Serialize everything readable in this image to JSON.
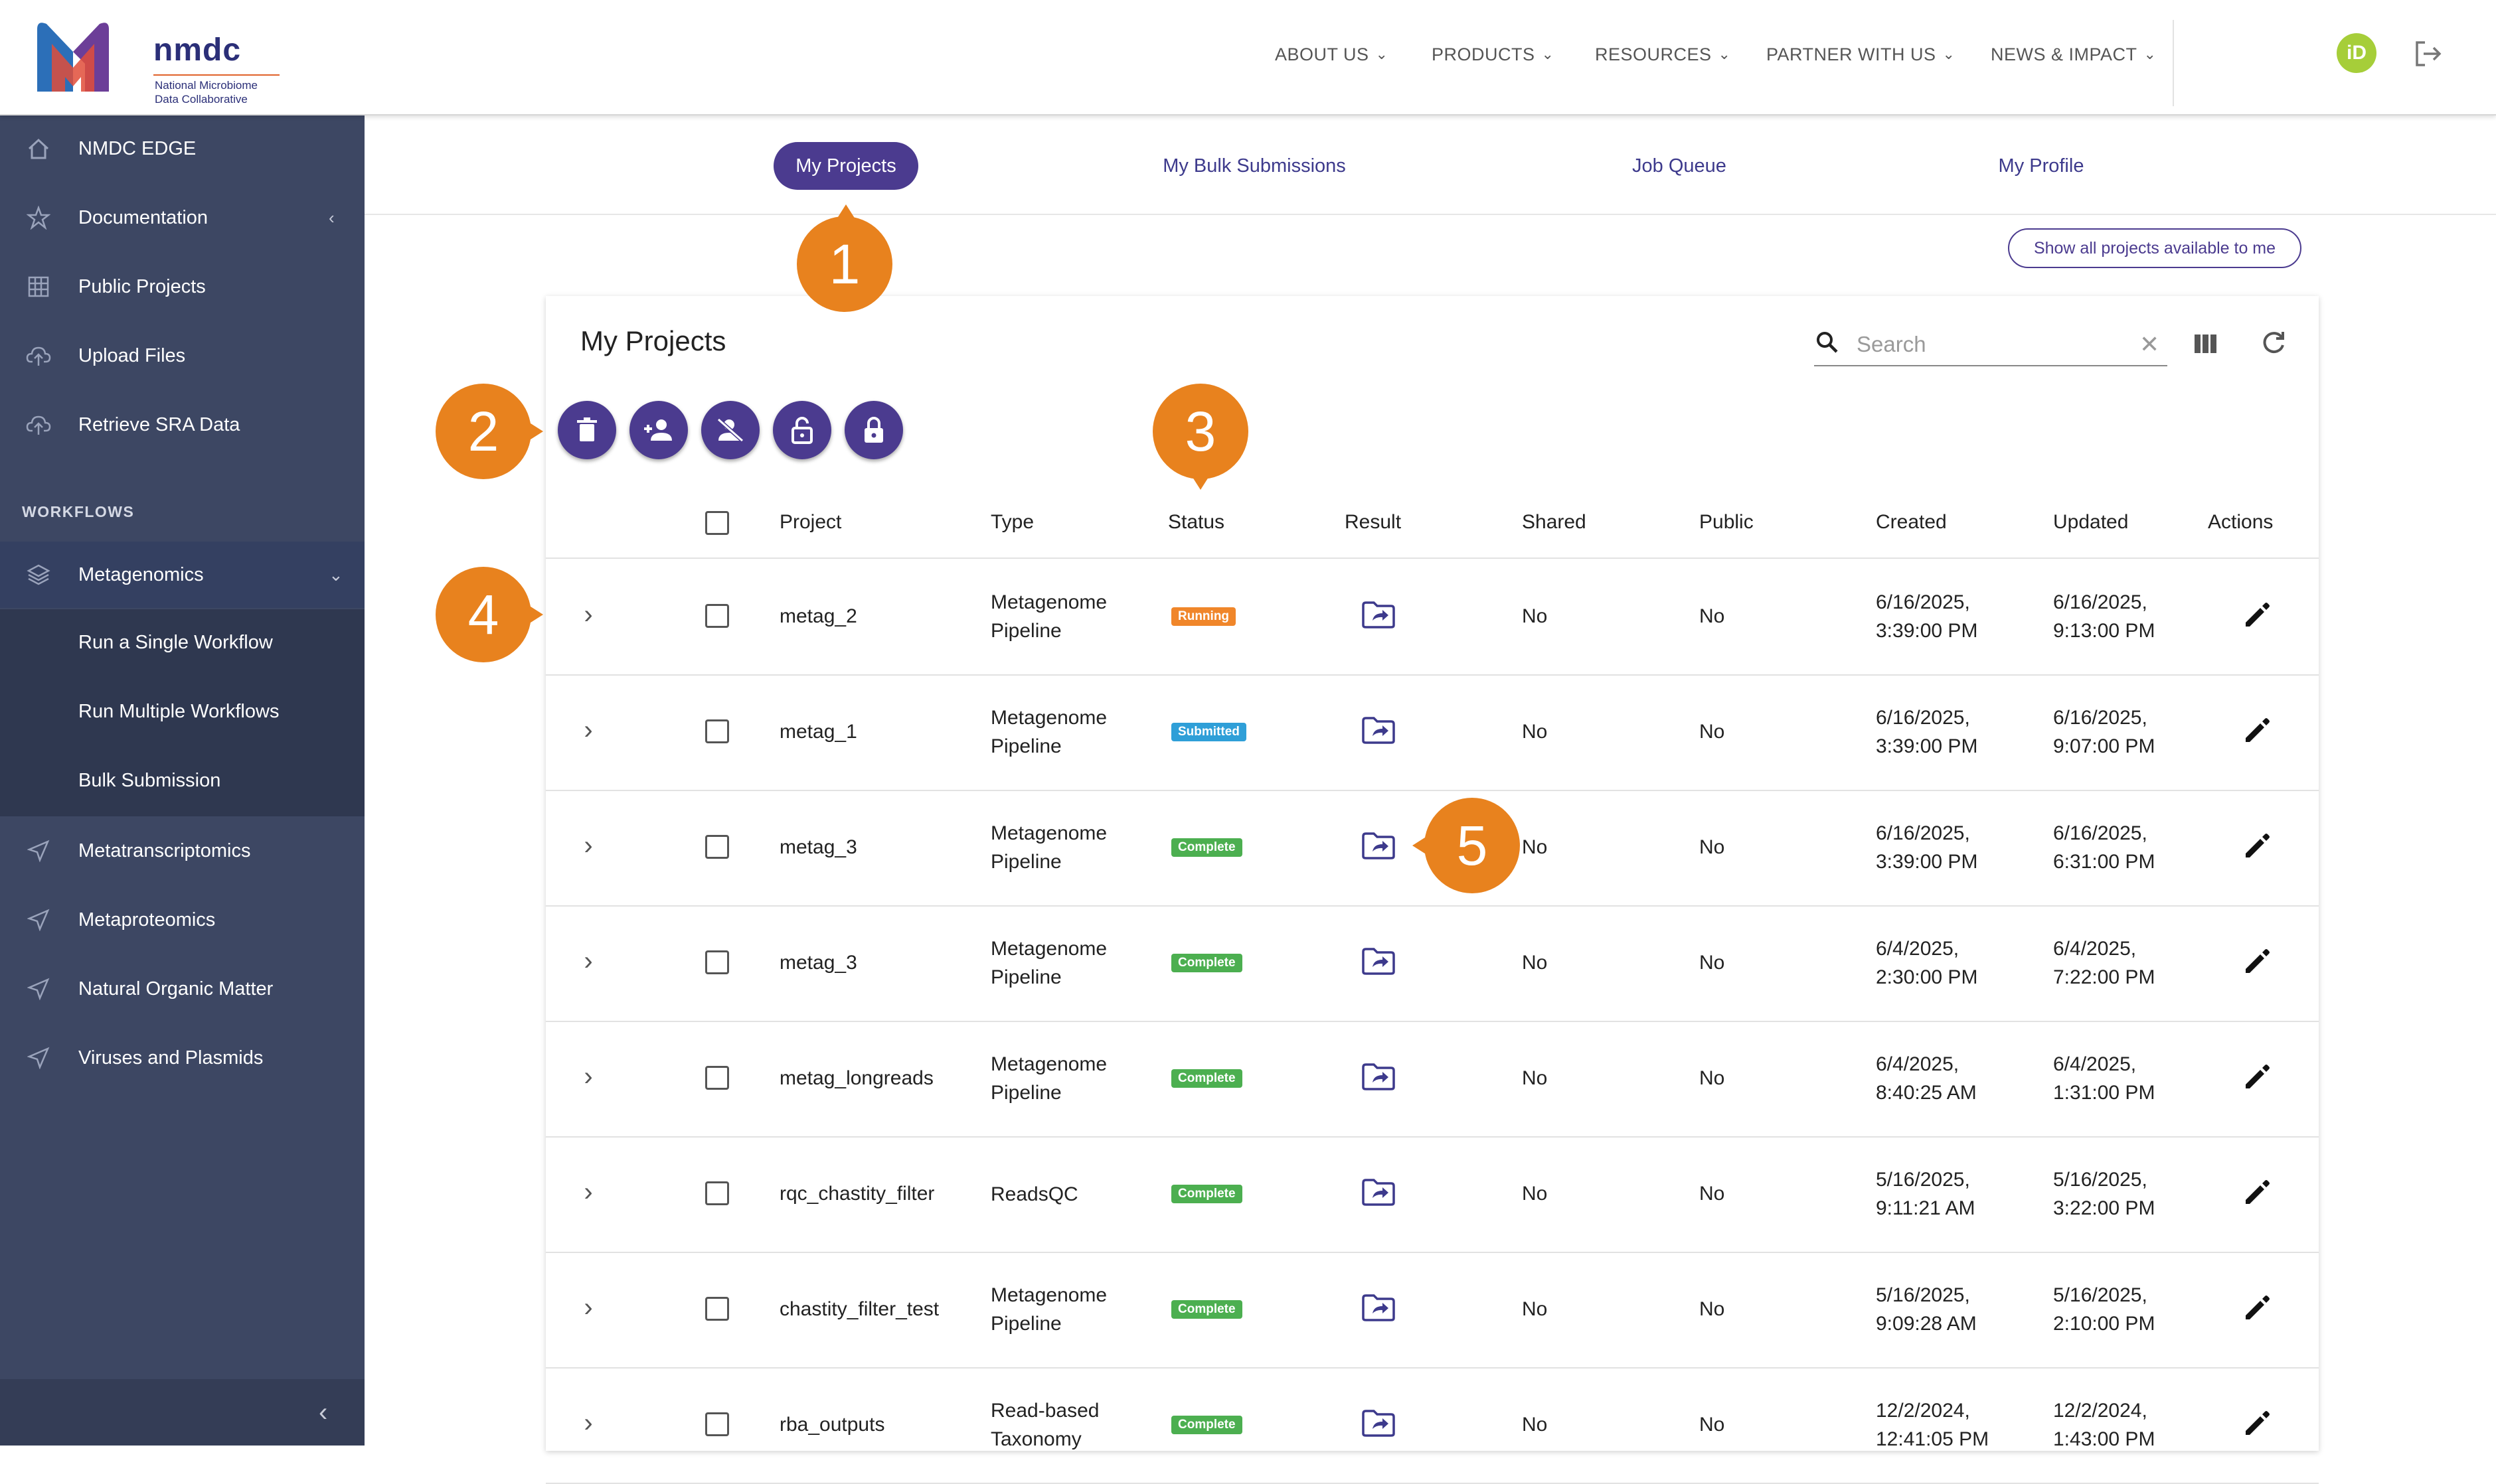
{
  "brand": {
    "name": "nmdc",
    "subtitle": [
      "National Microbiome",
      "Data Collaborative"
    ],
    "colors": {
      "purple": "#4b3b8f",
      "sidebar": "#3d4763",
      "accent": "#e8821e",
      "orcid": "#a6ce39"
    }
  },
  "topnav": [
    {
      "label": "ABOUT US"
    },
    {
      "label": "PRODUCTS"
    },
    {
      "label": "RESOURCES"
    },
    {
      "label": "PARTNER WITH US"
    },
    {
      "label": "NEWS & IMPACT"
    }
  ],
  "header_icons": {
    "orcid": "iD",
    "logout": "logout-icon"
  },
  "sidebar": {
    "items": [
      {
        "label": "NMDC EDGE",
        "icon": "home-icon"
      },
      {
        "label": "Documentation",
        "icon": "star-icon"
      },
      {
        "label": "Public Projects",
        "icon": "grid-icon"
      },
      {
        "label": "Upload Files",
        "icon": "cloud-upload-icon"
      },
      {
        "label": "Retrieve SRA Data",
        "icon": "cloud-download-icon"
      }
    ],
    "section": "WORKFLOWS",
    "workflow_items": [
      {
        "label": "Metagenomics",
        "icon": "layers-icon"
      },
      {
        "label": "Run a Single Workflow"
      },
      {
        "label": "Run Multiple Workflows"
      },
      {
        "label": "Bulk Submission"
      },
      {
        "label": "Metatranscriptomics",
        "icon": "send-icon"
      },
      {
        "label": "Metaproteomics",
        "icon": "send-icon"
      },
      {
        "label": "Natural Organic Matter",
        "icon": "send-icon"
      },
      {
        "label": "Viruses and Plasmids",
        "icon": "send-icon"
      }
    ]
  },
  "tabs": [
    {
      "label": "My Projects",
      "active": true
    },
    {
      "label": "My Bulk Submissions"
    },
    {
      "label": "Job Queue"
    },
    {
      "label": "My Profile"
    }
  ],
  "show_all_label": "Show all projects available to me",
  "table": {
    "title": "My Projects",
    "search_placeholder": "Search",
    "toolbar_icons": [
      "delete-icon",
      "share-user-icon",
      "unshare-user-icon",
      "make-public-icon",
      "make-private-icon"
    ],
    "columns": [
      "Project",
      "Type",
      "Status",
      "Result",
      "Shared",
      "Public",
      "Created",
      "Updated",
      "Actions"
    ],
    "rows": [
      {
        "project": "metag_2",
        "type": [
          "Metagenome",
          "Pipeline"
        ],
        "status": "Running",
        "shared": "No",
        "public": "No",
        "created": [
          "6/16/2025,",
          "3:39:00 PM"
        ],
        "updated": [
          "6/16/2025,",
          "9:13:00 PM"
        ]
      },
      {
        "project": "metag_1",
        "type": [
          "Metagenome",
          "Pipeline"
        ],
        "status": "Submitted",
        "shared": "No",
        "public": "No",
        "created": [
          "6/16/2025,",
          "3:39:00 PM"
        ],
        "updated": [
          "6/16/2025,",
          "9:07:00 PM"
        ]
      },
      {
        "project": "metag_3",
        "type": [
          "Metagenome",
          "Pipeline"
        ],
        "status": "Complete",
        "shared": "No",
        "public": "No",
        "created": [
          "6/16/2025,",
          "3:39:00 PM"
        ],
        "updated": [
          "6/16/2025,",
          "6:31:00 PM"
        ]
      },
      {
        "project": "metag_3",
        "type": [
          "Metagenome",
          "Pipeline"
        ],
        "status": "Complete",
        "shared": "No",
        "public": "No",
        "created": [
          "6/4/2025,",
          "2:30:00 PM"
        ],
        "updated": [
          "6/4/2025,",
          "7:22:00 PM"
        ]
      },
      {
        "project": "metag_longreads",
        "type": [
          "Metagenome",
          "Pipeline"
        ],
        "status": "Complete",
        "shared": "No",
        "public": "No",
        "created": [
          "6/4/2025,",
          "8:40:25 AM"
        ],
        "updated": [
          "6/4/2025,",
          "1:31:00 PM"
        ]
      },
      {
        "project": "rqc_chastity_filter",
        "type": [
          "ReadsQC",
          ""
        ],
        "status": "Complete",
        "shared": "No",
        "public": "No",
        "created": [
          "5/16/2025,",
          "9:11:21 AM"
        ],
        "updated": [
          "5/16/2025,",
          "3:22:00 PM"
        ]
      },
      {
        "project": "chastity_filter_test",
        "type": [
          "Metagenome",
          "Pipeline"
        ],
        "status": "Complete",
        "shared": "No",
        "public": "No",
        "created": [
          "5/16/2025,",
          "9:09:28 AM"
        ],
        "updated": [
          "5/16/2025,",
          "2:10:00 PM"
        ]
      },
      {
        "project": "rba_outputs",
        "type": [
          "Read-based",
          "Taxonomy"
        ],
        "status": "Complete",
        "shared": "No",
        "public": "No",
        "created": [
          "12/2/2024,",
          "12:41:05 PM"
        ],
        "updated": [
          "12/2/2024,",
          "1:43:00 PM"
        ]
      }
    ],
    "status_colors": {
      "Running": "#f0862a",
      "Submitted": "#2f9fd8",
      "Complete": "#4caf50"
    }
  },
  "callouts": [
    "1",
    "2",
    "3",
    "4",
    "5"
  ]
}
